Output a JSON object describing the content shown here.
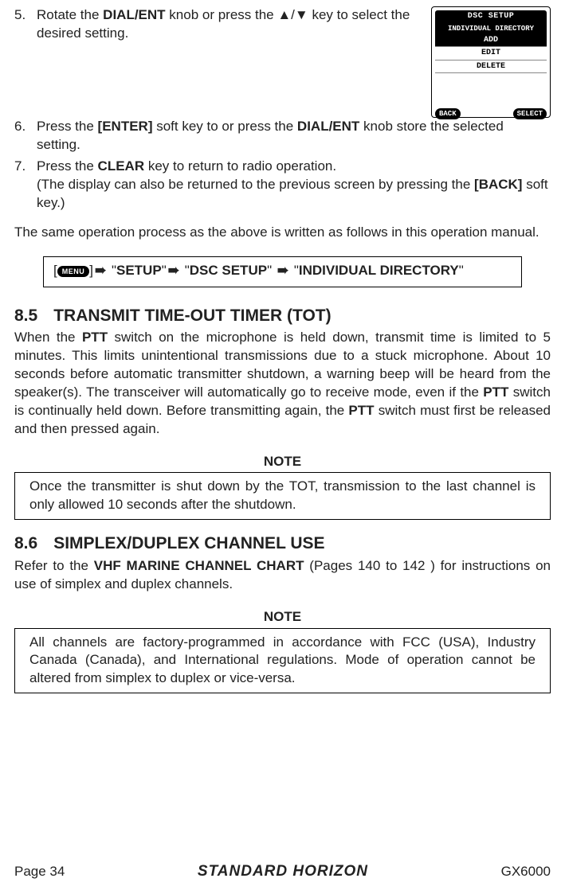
{
  "lcd": {
    "title": "DSC SETUP",
    "subtitle": "INDIVIDUAL DIRECTORY",
    "items": [
      "ADD",
      "EDIT",
      "DELETE"
    ],
    "selected_index": 0,
    "soft_back": "BACK",
    "soft_select": "SELECT"
  },
  "steps_a": {
    "n5": "5.",
    "t5a": "Rotate the ",
    "t5b": "DIAL/ENT",
    "t5c": " knob or press the ▲/▼ key to select the desired setting."
  },
  "steps_b": {
    "n6": "6.",
    "t6a": "Press the ",
    "t6b": "[ENTER]",
    "t6c": " soft key to or press the ",
    "t6d": "DIAL/ENT",
    "t6e": " knob store the selected setting.",
    "n7": "7.",
    "t7a": "Press the ",
    "t7b": "CLEAR",
    "t7c": " key to return to radio operation.",
    "t7d": "(The display can also be returned to the previous screen by pressing the ",
    "t7e": "[BACK]",
    "t7f": " soft key.)"
  },
  "intro_same": "The same operation process as the above is written as follows in this opera­tion manual.",
  "bc": {
    "menu": "MENU",
    "q1a": "\"",
    "s1": "SETUP",
    "q1b": "\"",
    "q2a": "\"",
    "s2": "DSC SETUP",
    "q2b": "\"",
    "q3a": "\"",
    "s3": "INDIVIDUAL DIRECTORY",
    "q3b": "\""
  },
  "sec85": {
    "num": "8.5",
    "title": "TRANSMIT TIME-OUT TIMER (TOT)",
    "p1a": "When the ",
    "p1b": "PTT",
    "p1c": " switch on the microphone is held down, transmit time is limited to 5 minutes. This limits unintentional transmissions due to a stuck microphone. About 10 seconds before automatic transmitter shutdown, a warning beep will be heard from the speaker(s). The transceiver will automatically go to receive mode, even if the ",
    "p1d": "PTT",
    "p1e": " switch is continually held down. Before transmitting again, the ",
    "p1f": "PTT",
    "p1g": " switch must first be released and then pressed again."
  },
  "note_label": "NOTE",
  "note1": "Once the transmitter is shut down by the TOT, transmission to the last channel is only allowed 10 seconds after the shutdown.",
  "sec86": {
    "num": "8.6",
    "title": "SIMPLEX/DUPLEX CHANNEL USE",
    "p1a": "Refer to the ",
    "p1b": "VHF MARINE CHANNEL CHART",
    "p1c": " (Pages 140 to 142 ) for instructions on use of simplex and duplex channels."
  },
  "note2": "All channels are factory-programmed in accordance with FCC (USA), Industry Canada (Canada), and International regulations. Mode of operation cannot be altered from simplex to duplex or vice-versa.",
  "footer": {
    "page": "Page 34",
    "brand": "STANDARD HORIZON",
    "model": "GX6000"
  }
}
